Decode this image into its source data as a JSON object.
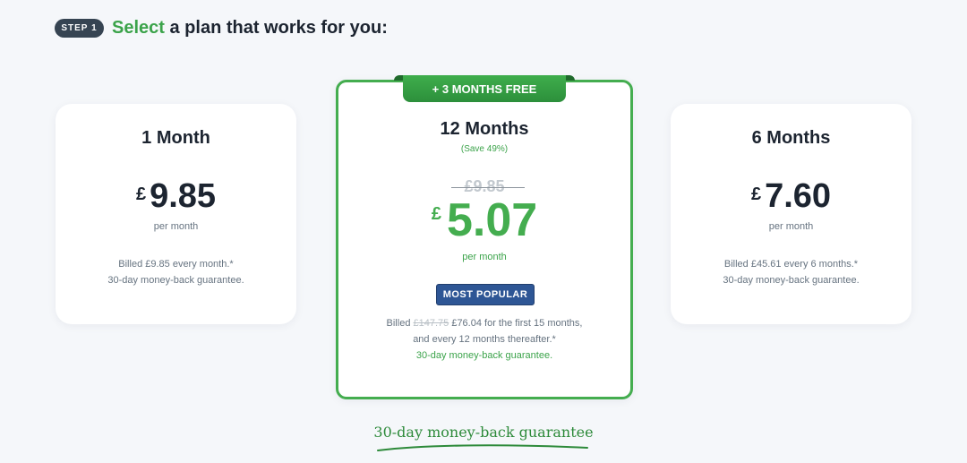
{
  "step": {
    "badge": "STEP 1",
    "title_highlight": "Select",
    "title_rest": " a plan that works for you:"
  },
  "plans": [
    {
      "name": "1 Month",
      "currency": "£",
      "price": "9.85",
      "per": "per month",
      "billed_line1": "Billed £9.85 every month.*",
      "billed_line2": "30-day money-back guarantee."
    },
    {
      "ribbon": "+ 3 MONTHS FREE",
      "name": "12 Months",
      "save": "(Save 49%)",
      "old_price": "£9.85",
      "currency": "£",
      "price": "5.07",
      "per": "per month",
      "badge": "MOST POPULAR",
      "billed_prefix": "Billed ",
      "billed_old": "£147.75",
      "billed_rest": " £76.04 for the first 15 months,",
      "billed_line2": "and every 12 months thereafter.*",
      "billed_line3": "30-day money-back guarantee."
    },
    {
      "name": "6 Months",
      "currency": "£",
      "price": "7.60",
      "per": "per month",
      "billed_line1": "Billed £45.61 every 6 months.*",
      "billed_line2": "30-day money-back guarantee."
    }
  ],
  "footer": {
    "guarantee": "30-day money-back guarantee"
  },
  "colors": {
    "accent_green": "#3ba34a",
    "popular_blue": "#2e5695",
    "step_badge": "#364452"
  }
}
